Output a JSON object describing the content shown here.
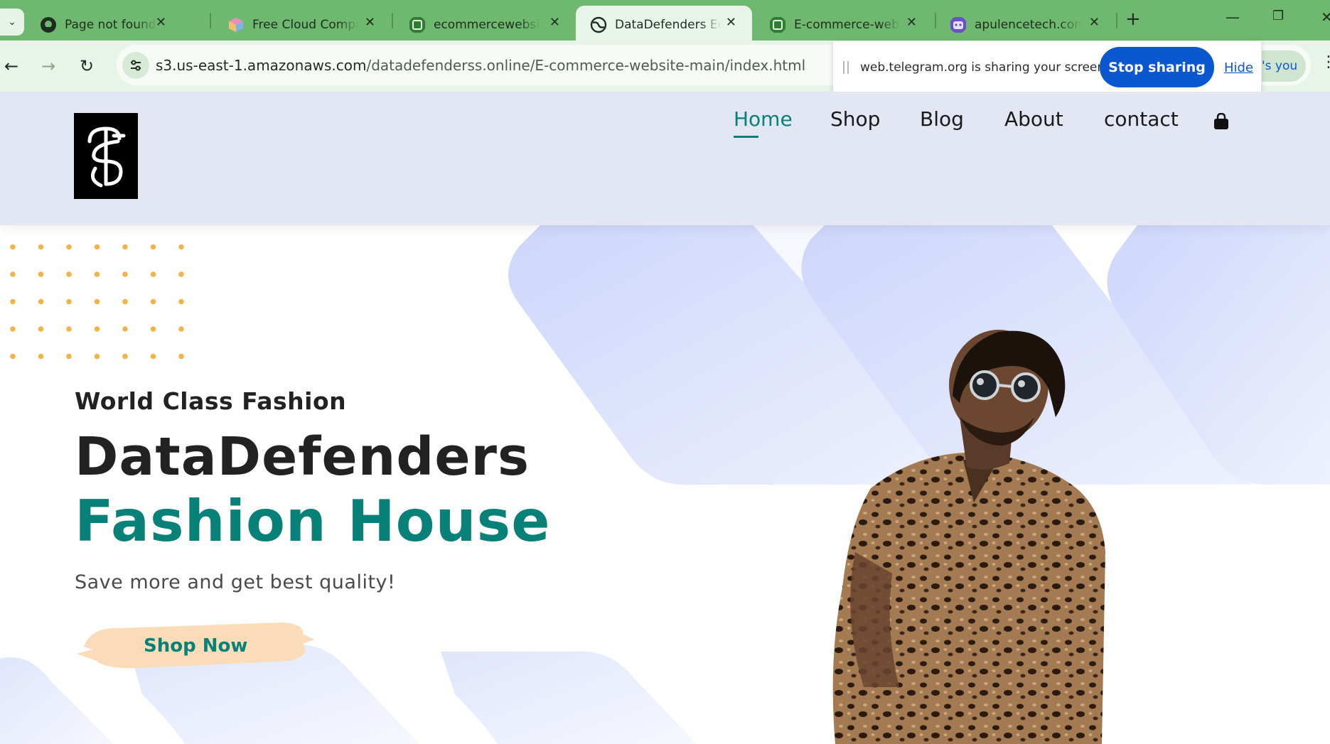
{
  "browser": {
    "tabs": [
      {
        "title": "Page not found · GitHub",
        "icon": "github-icon",
        "active": false
      },
      {
        "title": "Free Cloud Computing",
        "icon": "cloud-cube-icon",
        "active": false
      },
      {
        "title": "ecommercewebsite",
        "icon": "s3-bucket-icon",
        "active": false
      },
      {
        "title": "DataDefenders Ecommerce",
        "icon": "globe-icon",
        "active": true
      },
      {
        "title": "E-commerce-website",
        "icon": "s3-bucket-icon",
        "active": false
      },
      {
        "title": "apulencetech.com",
        "icon": "robot-icon",
        "active": false
      }
    ],
    "close_glyph": "✕",
    "new_tab_glyph": "+",
    "url_host": "s3.us-east-1.amazonaws.com",
    "url_path": "/datadefenderss.online/E-commerce-website-main/index.html",
    "share_bar": {
      "message": "web.telegram.org is sharing your screen.",
      "stop_label": "Stop sharing",
      "hide_label": "Hide"
    },
    "peek_chip_text": "'s you",
    "colors": {
      "frame": "#6fb86f",
      "toolbar": "#e9f4e9",
      "accent_blue": "#0b57d0"
    }
  },
  "site": {
    "nav": [
      {
        "label": "Home",
        "active": true
      },
      {
        "label": "Shop",
        "active": false
      },
      {
        "label": "Blog",
        "active": false
      },
      {
        "label": "About",
        "active": false
      },
      {
        "label": "contact",
        "active": false
      }
    ],
    "cart_icon": "shopping-bag-icon",
    "hero": {
      "eyebrow": "World Class Fashion",
      "heading": "DataDefenders",
      "subheading": "Fashion House",
      "tagline": "Save more and get best quality!",
      "cta_label": "Shop Now"
    },
    "colors": {
      "brand_teal": "#088178",
      "header_bg": "#e3e6f3",
      "dots": "#f5b347",
      "shape_blue": "#d6defc"
    }
  }
}
